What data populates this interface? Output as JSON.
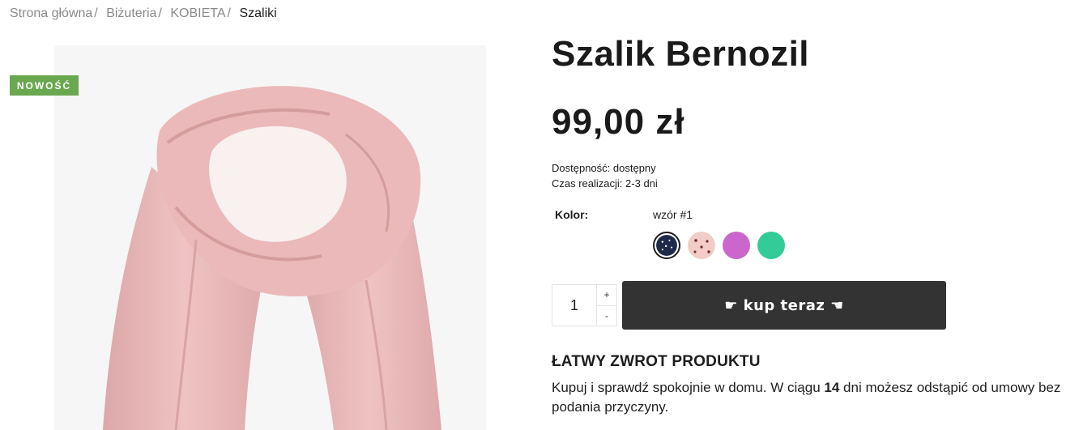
{
  "breadcrumb": {
    "items": [
      "Strona główna",
      "Biżuteria",
      "KOBIETA"
    ],
    "separator": "/",
    "current": "Szaliki"
  },
  "product": {
    "badge": "NOWOŚĆ",
    "title": "Szalik Bernozil",
    "price": "99,00 zł",
    "availability_label": "Dostępność:",
    "availability_value": "dostępny",
    "lead_time_label": "Czas realizacji:",
    "lead_time_value": "2-3 dni",
    "image_icon": "pink-scarf-image"
  },
  "options": {
    "color_label": "Kolor:",
    "selected_pattern": "wzór #1",
    "swatches": [
      {
        "name": "navy-dotted",
        "color": "#1f2a4a"
      },
      {
        "name": "pink-dotted",
        "color": "#f2ccc6"
      },
      {
        "name": "purple",
        "color": "#cc66cc"
      },
      {
        "name": "green",
        "color": "#33cc99"
      }
    ]
  },
  "purchase": {
    "quantity": "1",
    "plus": "+",
    "minus": "-",
    "buy_label": "☛ kup teraz ☚"
  },
  "returns": {
    "title": "ŁATWY ZWROT PRODUKTU",
    "text_before": "Kupuj i sprawdź spokojnie w domu. W ciągu ",
    "days": "14",
    "text_after": " dni możesz odstąpić od umowy bez podania przyczyny."
  }
}
